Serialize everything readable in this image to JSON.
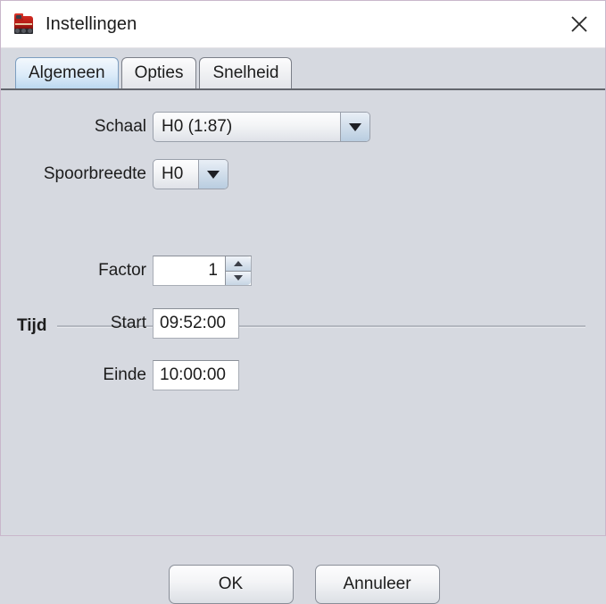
{
  "window": {
    "title": "Instellingen",
    "icon": "locomotive-icon",
    "close_label": "close-icon"
  },
  "tabs": [
    {
      "label": "Algemeen",
      "active": true
    },
    {
      "label": "Opties",
      "active": false
    },
    {
      "label": "Snelheid",
      "active": false
    }
  ],
  "form": {
    "scale": {
      "label": "Schaal",
      "value": "H0 (1:87)"
    },
    "gauge": {
      "label": "Spoorbreedte",
      "value": "H0"
    },
    "time_section": {
      "label": "Tijd",
      "factor": {
        "label": "Factor",
        "value": "1"
      },
      "start": {
        "label": "Start",
        "value": "09:52:00"
      },
      "end": {
        "label": "Einde",
        "value": "10:00:00"
      }
    }
  },
  "buttons": {
    "ok": "OK",
    "cancel": "Annuleer"
  },
  "colors": {
    "window_bg": "#d6d9e0",
    "titlebar_bg": "#ffffff",
    "active_tab": "#bcd8f0",
    "border": "#c9b7cb"
  }
}
